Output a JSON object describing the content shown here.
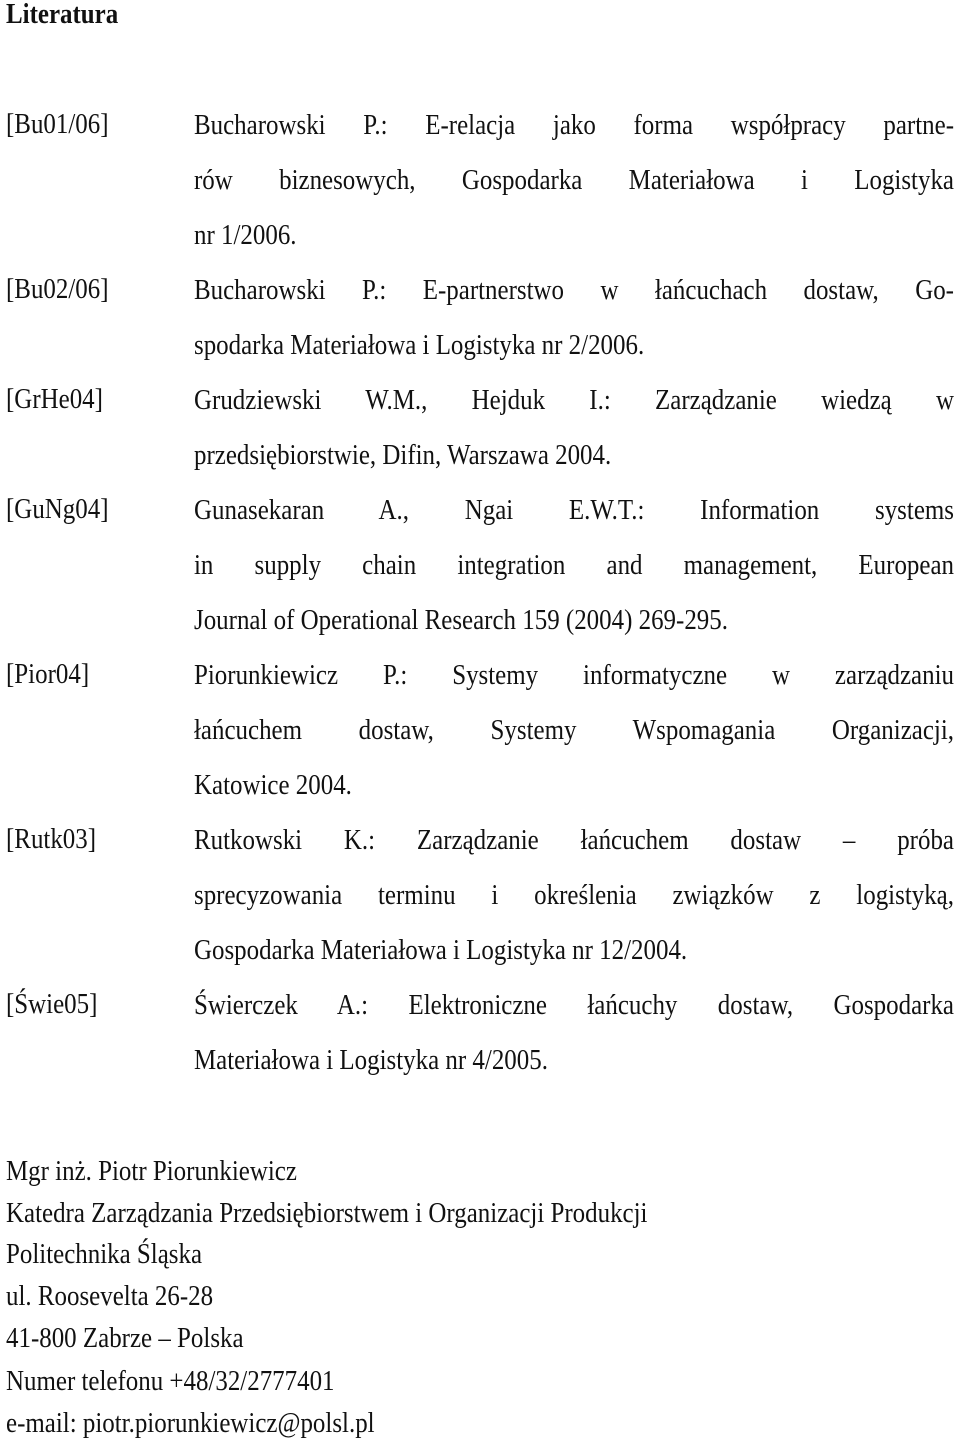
{
  "heading": "Literatura",
  "references": [
    {
      "key": "[Bu01/06]",
      "lines": [
        "Bucharowski P.: E-relacja jako forma współpracy partne-",
        "rów biznesowych, Gospodarka Materiałowa i Logistyka",
        "nr 1/2006."
      ]
    },
    {
      "key": "[Bu02/06]",
      "lines": [
        "Bucharowski P.: E-partnerstwo w łańcuchach dostaw, Go-",
        "spodarka Materiałowa i Logistyka nr 2/2006."
      ]
    },
    {
      "key": "[GrHe04]",
      "lines": [
        "Grudziewski W.M., Hejduk I.: Zarządzanie wiedzą w",
        "przedsiębiorstwie, Difin, Warszawa 2004."
      ]
    },
    {
      "key": "[GuNg04]",
      "lines": [
        "Gunasekaran A., Ngai E.W.T.: Information systems",
        "in supply chain integration and management, European",
        "Journal of Operational Research 159 (2004) 269-295."
      ]
    },
    {
      "key": "[Pior04]",
      "lines": [
        "Piorunkiewicz P.: Systemy informatyczne w zarządzaniu",
        "łańcuchem dostaw, Systemy Wspomagania Organizacji,",
        "Katowice 2004."
      ]
    },
    {
      "key": "[Rutk03]",
      "lines": [
        "Rutkowski K.: Zarządzanie łańcuchem dostaw – próba",
        "sprecyzowania terminu i określenia związków z logistyką,",
        "Gospodarka Materiałowa i Logistyka nr 12/2004."
      ]
    },
    {
      "key": "[Świe05]",
      "lines": [
        "Świerczek A.: Elektroniczne łańcuchy dostaw, Gospodarka",
        "Materiałowa i Logistyka nr 4/2005."
      ]
    }
  ],
  "author": {
    "name": "Mgr inż. Piotr Piorunkiewicz",
    "department": "Katedra Zarządzania Przedsiębiorstwem i Organizacji Produkcji",
    "university": "Politechnika Śląska",
    "street": "ul. Roosevelta 26-28",
    "city": "41-800 Zabrze – Polska",
    "phone": "Numer telefonu +48/32/2777401",
    "email": "e-mail: piotr.piorunkiewicz@polsl.pl"
  }
}
